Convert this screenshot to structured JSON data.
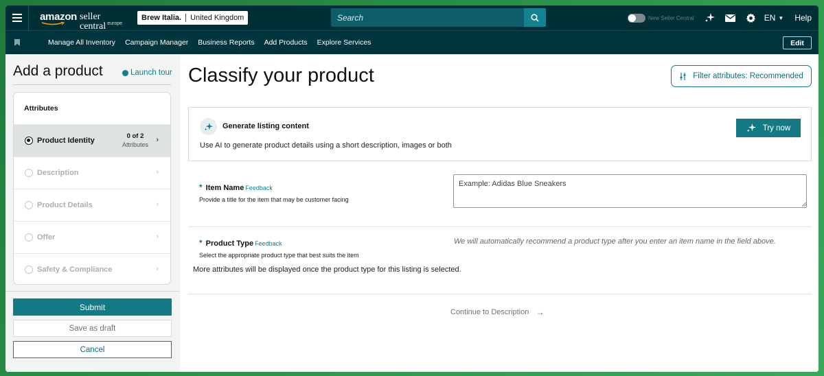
{
  "colors": {
    "topbar": "#002f36",
    "navbar": "#00353d",
    "accent": "#117d88",
    "button": "#137a85"
  },
  "header": {
    "brand": "amazon",
    "brand2": "seller central",
    "region": "europe",
    "store": "Brew Italia.",
    "marketplace": "United Kingdom",
    "search_placeholder": "Search",
    "new_seller_central": "New Seller Central",
    "language": "EN",
    "help": "Help",
    "icons": [
      "menu-icon",
      "search-icon",
      "sparkle-icon",
      "mail-icon",
      "gear-icon"
    ]
  },
  "nav": {
    "items": [
      "Manage All Inventory",
      "Campaign Manager",
      "Business Reports",
      "Add Products",
      "Explore Services"
    ],
    "edit": "Edit"
  },
  "left": {
    "title": "Add a product",
    "launch_tour": "Launch tour",
    "attributes_heading": "Attributes",
    "steps": [
      {
        "label": "Product Identity",
        "count": "0 of 2",
        "count_label": "Attributes",
        "active": true
      },
      {
        "label": "Description",
        "active": false
      },
      {
        "label": "Product Details",
        "active": false
      },
      {
        "label": "Offer",
        "active": false
      },
      {
        "label": "Safety & Compliance",
        "active": false
      }
    ],
    "submit": "Submit",
    "save_draft": "Save as draft",
    "cancel": "Cancel"
  },
  "main": {
    "title": "Classify your product",
    "filter_button": "Filter attributes: Recommended",
    "generate": {
      "title": "Generate listing content",
      "description": "Use AI to generate product details using a short description, images or both",
      "button": "Try now"
    },
    "item_name": {
      "required": "*",
      "label": "Item Name",
      "feedback": "Feedback",
      "description": "Provide a title for the item that may be customer facing",
      "placeholder": "Example: Adidas Blue Sneakers"
    },
    "product_type": {
      "required": "*",
      "label": "Product Type",
      "feedback": "Feedback",
      "description": "Select the appropriate product type that best suits the item",
      "hint": "We will automatically recommend a product type after you enter an item name in the field above."
    },
    "more_attributes": "More attributes will be displayed once the product type for this listing is selected.",
    "continue": "Continue to Description"
  }
}
